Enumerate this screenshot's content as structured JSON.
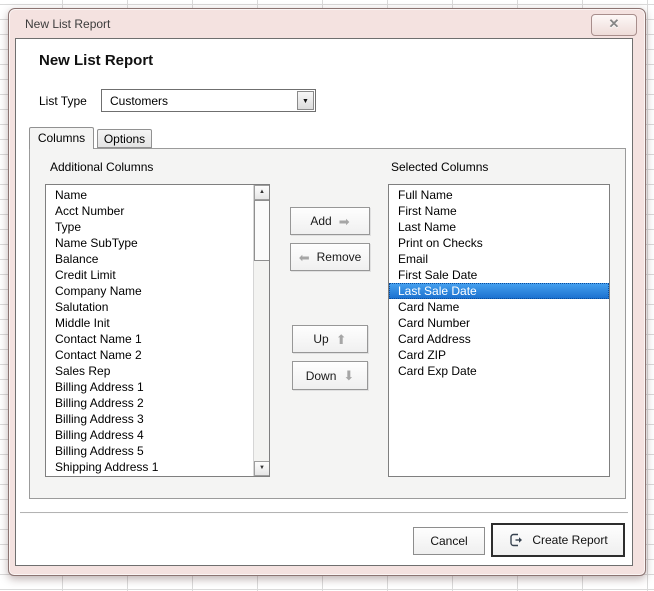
{
  "window": {
    "title": "New List Report",
    "close_icon": "✕"
  },
  "dialog": {
    "heading": "New List Report",
    "list_type": {
      "label": "List Type",
      "value": "Customers",
      "dropdown_icon": "▼"
    },
    "tabs": [
      {
        "label": "Columns",
        "active": true
      },
      {
        "label": "Options",
        "active": false
      }
    ],
    "columns_tab": {
      "available_label": "Additional Columns",
      "selected_label": "Selected Columns",
      "available_items": [
        "Name",
        "Acct Number",
        "Type",
        "Name SubType",
        "Balance",
        "Credit Limit",
        "Company Name",
        "Salutation",
        "Middle Init",
        "Contact Name 1",
        "Contact Name 2",
        "Sales Rep",
        "Billing Address 1",
        "Billing Address 2",
        "Billing Address 3",
        "Billing Address 4",
        "Billing Address 5",
        "Shipping Address 1"
      ],
      "selected_items": [
        "Full Name",
        "First Name",
        "Last Name",
        "Print on Checks",
        "Email",
        "First Sale Date",
        "Last Sale Date",
        "Card Name",
        "Card Number",
        "Card Address",
        "Card ZIP",
        "Card Exp Date"
      ],
      "selected_index": 6,
      "highlighted_item": "Last Sale Date",
      "buttons": {
        "add": "Add",
        "remove": "Remove",
        "up": "Up",
        "down": "Down",
        "add_arrow": "➡",
        "remove_arrow": "⬅",
        "up_arrow": "⬆",
        "down_arrow": "⬇"
      },
      "scrollbar": {
        "up_icon": "▲",
        "down_icon": "▼"
      }
    },
    "footer": {
      "cancel": "Cancel",
      "create": "Create Report"
    }
  },
  "colors": {
    "titlebar_pink": "#f4e2e0",
    "selection_blue_top": "#47a2f0",
    "selection_blue_bottom": "#1a6fce",
    "tabpage_gray": "#f4f4f3",
    "list_border": "#7f7f7f"
  }
}
